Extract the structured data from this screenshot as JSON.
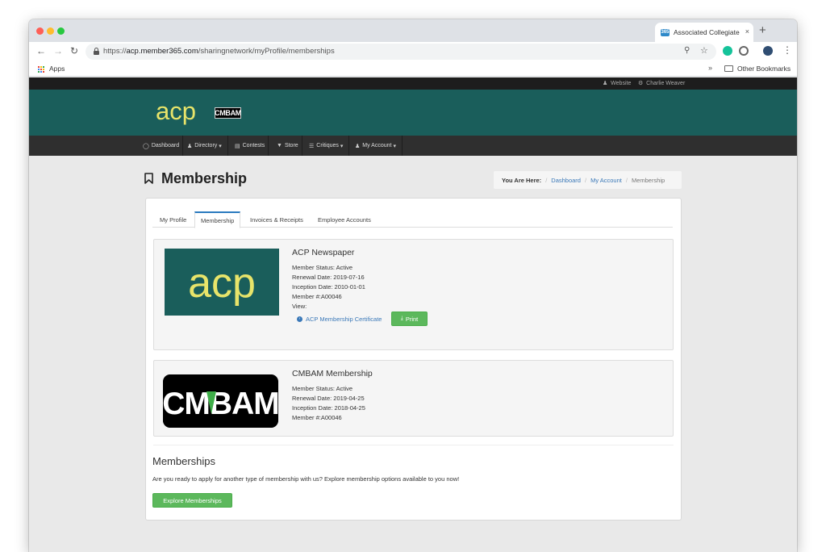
{
  "browser": {
    "tab_title": "Associated Collegiate",
    "tab_close": "×",
    "new_tab": "+",
    "url_scheme": "https://",
    "url_host": "acp.member365.com",
    "url_path": "/sharingnetwork/myProfile/memberships",
    "apps_label": "Apps",
    "more_bookmarks": "»",
    "other_bookmarks": "Other Bookmarks"
  },
  "site": {
    "topbar_website": "Website",
    "topbar_user": "Charlie Weaver",
    "logo_acp": "acp",
    "logo_cmbam": "CMBAM",
    "nav": [
      {
        "label": "Dashboard",
        "icon": "dashboard-icon"
      },
      {
        "label": "Directory",
        "icon": "users-icon",
        "dropdown": true
      },
      {
        "label": "Contests",
        "icon": "book-icon"
      },
      {
        "label": "Store",
        "icon": "cart-icon"
      },
      {
        "label": "Critiques",
        "icon": "list-icon",
        "dropdown": true
      },
      {
        "label": "My Account",
        "icon": "user-icon",
        "dropdown": true
      }
    ]
  },
  "page": {
    "title": "Membership",
    "breadcrumb": {
      "label": "You Are Here:",
      "items": [
        "Dashboard",
        "My Account",
        "Membership"
      ]
    },
    "tabs": [
      "My Profile",
      "Membership",
      "Invoices & Receipts",
      "Employee Accounts"
    ],
    "active_tab": "Membership",
    "memberships": [
      {
        "name": "ACP Newspaper",
        "logo_text": "acp",
        "status": "Member Status: Active",
        "renewal": "Renewal Date: 2019-07-16",
        "inception": "Inception Date: 2010-01-01",
        "member_no": "Member #:A00046",
        "view_label": "View:",
        "certificate_link": "ACP Membership Certificate",
        "print_label": "Print"
      },
      {
        "name": "CMBAM Membership",
        "logo_text": "CMBAM",
        "status": "Member Status: Active",
        "renewal": "Renewal Date: 2019-04-25",
        "inception": "Inception Date: 2018-04-25",
        "member_no": "Member #:A00046"
      }
    ],
    "memberships_section": {
      "title": "Memberships",
      "text": "Are you ready to apply for another type of membership with us? Explore membership options available to you now!",
      "button": "Explore Memberships"
    }
  },
  "colors": {
    "header_teal": "#1a5e5b",
    "acp_yellow": "#e8e46a",
    "button_green": "#5cb85c",
    "link_blue": "#3a78b8"
  }
}
